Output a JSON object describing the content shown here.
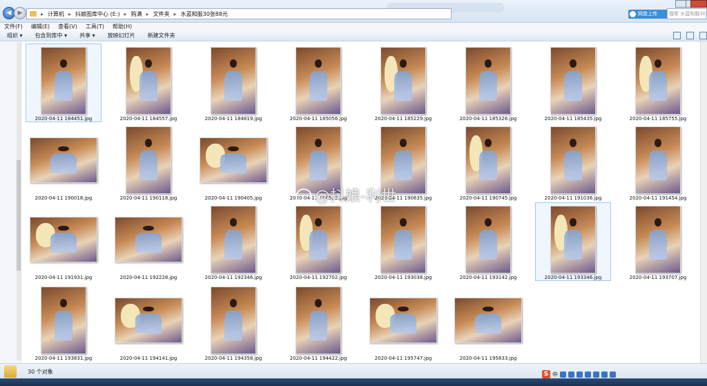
{
  "address": {
    "crumbs": [
      "计算机",
      "抖娘图库中心 (E:)",
      "购满",
      "文件夹",
      "水蓝和服30张88元"
    ],
    "cloud_label": "网盘上传",
    "search_placeholder": "搜索 水蓝和服30张88元"
  },
  "menu": [
    "文件(F)",
    "编辑(E)",
    "查看(V)",
    "工具(T)",
    "帮助(H)"
  ],
  "toolbar": [
    "组织 ▾",
    "包含到库中 ▾",
    "共享 ▾",
    "放映幻灯片",
    "新建文件夹"
  ],
  "files": [
    "2020-04-11 184451.jpg",
    "2020-04-11 184557.jpg",
    "2020-04-11 184819.jpg",
    "2020-04-11 185056.jpg",
    "2020-04-11 185229.jpg",
    "2020-04-11 185326.jpg",
    "2020-04-11 185435.jpg",
    "2020-04-11 185755.jpg",
    "2020-04-11 190018.jpg",
    "2020-04-11 190118.jpg",
    "2020-04-11 190405.jpg",
    "2020-04-11 190523.jpg",
    "2020-04-11 190635.jpg",
    "2020-04-11 190745.jpg",
    "2020-04-11 191036.jpg",
    "2020-04-11 191454.jpg",
    "2020-04-11 191931.jpg",
    "2020-04-11 192228.jpg",
    "2020-04-11 192346.jpg",
    "2020-04-11 192702.jpg",
    "2020-04-11 193038.jpg",
    "2020-04-11 193142.jpg",
    "2020-04-11 193346.jpg",
    "2020-04-11 193707.jpg",
    "2020-04-11 193831.jpg",
    "2020-04-11 194141.jpg",
    "2020-04-11 194358.jpg",
    "2020-04-11 194422.jpg",
    "2020-04-11 195747.jpg",
    "2020-04-11 195833.jpg"
  ],
  "watermark": "@抖娘-利世",
  "status": "30 个对象",
  "ime_logo": "S",
  "ime_mode": "中"
}
